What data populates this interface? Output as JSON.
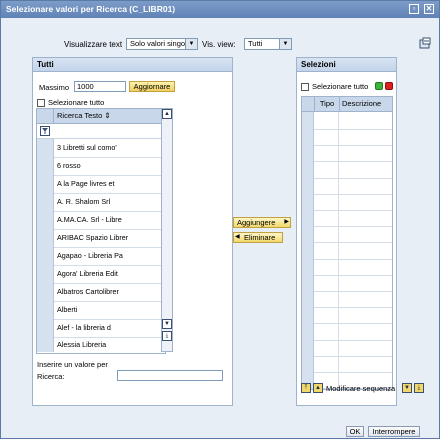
{
  "window": {
    "title": "Selezionare valori per Ricerca (C_LIBR01)",
    "buttons": [
      "restore-icon",
      "close-icon"
    ]
  },
  "toolbar": {
    "display_label": "Visualizzare text",
    "display_value": "Solo valori singoli",
    "view_label": "Vis. view:",
    "view_value": "Tutti",
    "settings_icon": "settings-icon"
  },
  "left_panel": {
    "title": "Tutti",
    "max_label": "Massimo",
    "max_value": "1000",
    "update_button": "Aggiornare",
    "select_all": "Selezionare tutto",
    "column_header": "Ricerca Testo",
    "filter_icon": "filter-icon",
    "rows": [
      "3 Libretti sul como'",
      "6 rosso",
      "A la Page livres et",
      "A. R. Shalom Srl",
      "A.MA.CA. Srl - Libre",
      "ARIBAC Spazio Librer",
      "Agapao - Libreria Pa",
      "Agora' Libreria Edit",
      "Albatros Cartolibrer",
      "Alberti",
      "Alef - la libreria d",
      "Alessia Libreria"
    ],
    "input_label_1": "Inserire un valore per",
    "input_label_2": "Ricerca:",
    "input_value": ""
  },
  "middle": {
    "add_button": "Aggiungere",
    "remove_button": "Eliminare"
  },
  "right_panel": {
    "title": "Selezioni",
    "select_all": "Selezionare tutto",
    "col_type": "Tipo",
    "col_desc": "Descrizione",
    "row_count": 17,
    "change_order": "Modificare sequenza",
    "green": "#3cb43c",
    "red": "#e02020"
  },
  "footer": {
    "ok": "OK",
    "cancel": "Interrompere"
  }
}
